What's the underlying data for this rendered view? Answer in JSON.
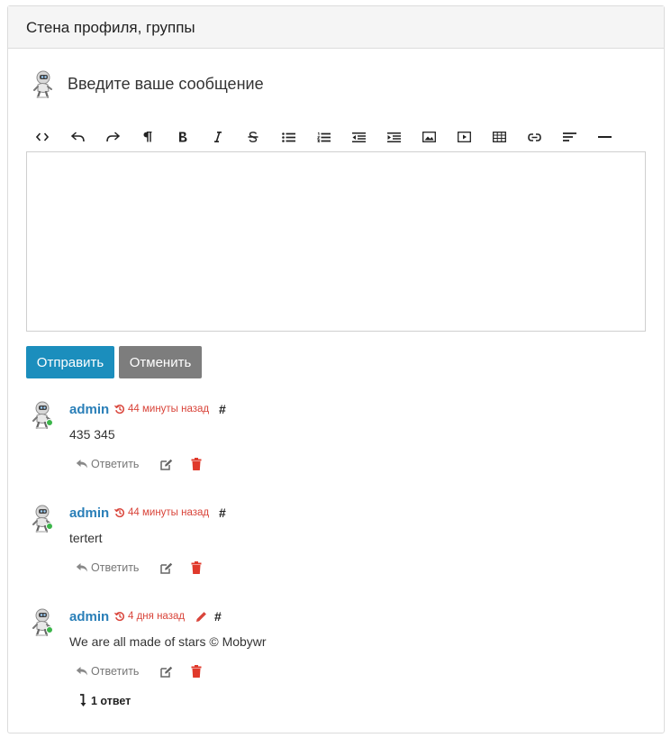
{
  "wall": {
    "title": "Стена профиля, группы",
    "compose_prompt": "Введите ваше сообщение",
    "send_label": "Отправить",
    "cancel_label": "Отменить"
  },
  "toolbar": [
    "code-view-icon",
    "undo-icon",
    "redo-icon",
    "paragraph-icon",
    "bold-icon",
    "italic-icon",
    "strikethrough-icon",
    "bullet-list-icon",
    "numbered-list-icon",
    "outdent-icon",
    "indent-icon",
    "image-icon",
    "video-icon",
    "table-icon",
    "link-icon",
    "align-icon",
    "horizontal-rule-icon"
  ],
  "comments": [
    {
      "author": "admin",
      "time": "44 минуты назад",
      "hash": "#",
      "text": "435 345",
      "reply_label": "Ответить",
      "edited": false
    },
    {
      "author": "admin",
      "time": "44 минуты назад",
      "hash": "#",
      "text": "tertert",
      "reply_label": "Ответить",
      "edited": false
    },
    {
      "author": "admin",
      "time": "4 дня назад",
      "hash": "#",
      "text": "We are all made of stars © Mobywr",
      "reply_label": "Ответить",
      "edited": true,
      "replies_label": "1 ответ"
    }
  ],
  "colors": {
    "primary": "#1b8ebd",
    "secondary": "#7d7d7d",
    "link": "#2a7fb8",
    "danger": "#d9443a",
    "online": "#3bb54a"
  }
}
